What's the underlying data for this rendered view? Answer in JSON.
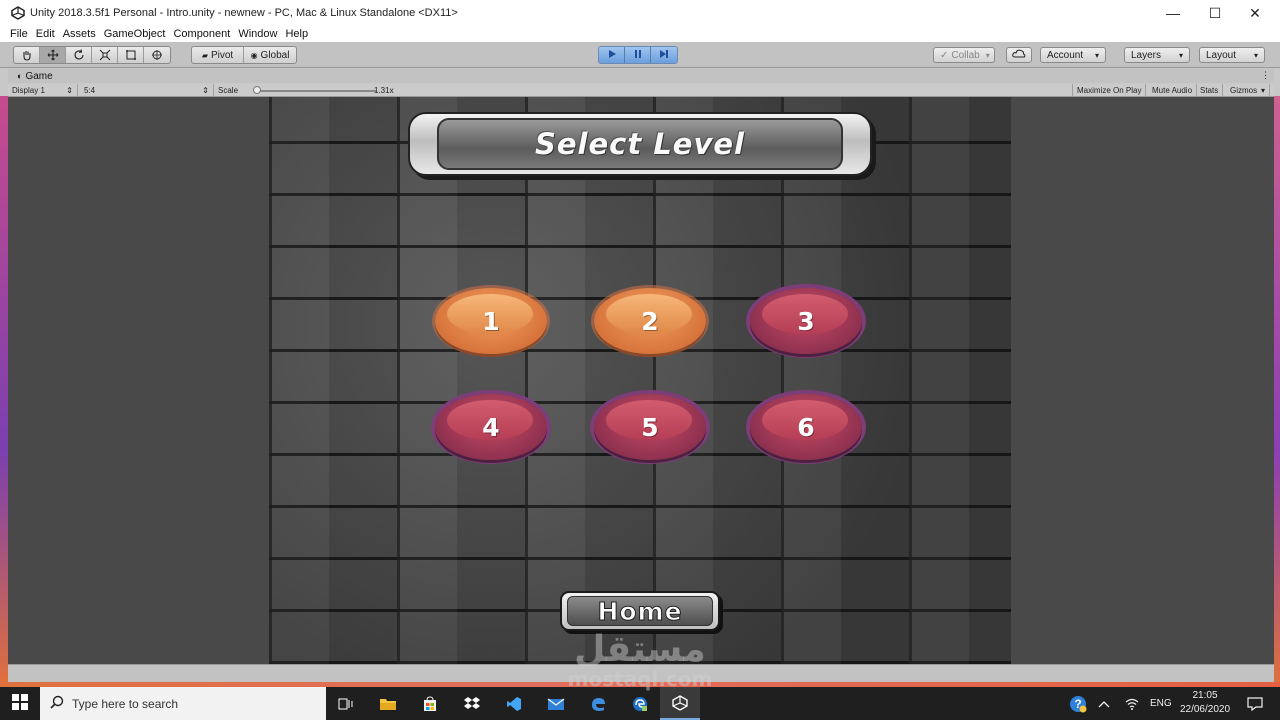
{
  "window": {
    "title": "Unity 2018.3.5f1 Personal - Intro.unity - newnew - PC, Mac & Linux Standalone <DX11>",
    "minimize_glyph": "—",
    "maximize_glyph": "☐",
    "close_glyph": "✕"
  },
  "menu": [
    "File",
    "Edit",
    "Assets",
    "GameObject",
    "Component",
    "Window",
    "Help"
  ],
  "toolbar": {
    "tools": [
      "hand-tool",
      "move-tool",
      "rotate-tool",
      "scale-tool",
      "rect-tool",
      "transform-tool"
    ],
    "active_tool_index": 1,
    "pivot_label": "Pivot",
    "global_label": "Global",
    "collab_label": "Collab",
    "account_label": "Account",
    "layers_label": "Layers",
    "layout_label": "Layout",
    "play_state": "playing"
  },
  "game_panel": {
    "tab_label": "Game",
    "display_label": "Display 1",
    "aspect_label": "5:4",
    "scale_label": "Scale",
    "scale_value": "1.31x",
    "maximize_on_play": "Maximize On Play",
    "mute_audio": "Mute Audio",
    "stats": "Stats",
    "gizmos": "Gizmos"
  },
  "game": {
    "title": "Select Level",
    "levels": [
      {
        "label": "1",
        "state": "unlocked"
      },
      {
        "label": "2",
        "state": "unlocked"
      },
      {
        "label": "3",
        "state": "locked"
      },
      {
        "label": "4",
        "state": "locked"
      },
      {
        "label": "5",
        "state": "locked"
      },
      {
        "label": "6",
        "state": "locked"
      }
    ],
    "home_label": "Home",
    "colors": {
      "unlocked": "#e08848",
      "locked": "#b53e56",
      "locked_ring": "#7c3d78"
    }
  },
  "watermark": {
    "arabic": "مستقل",
    "latin": "mostaql.com"
  },
  "taskbar": {
    "search_placeholder": "Type here to search",
    "apps": [
      "task-view-icon",
      "file-explorer-icon",
      "store-icon",
      "dropbox-icon",
      "visual-studio-icon",
      "mail-icon",
      "edge-icon",
      "edge-dev-icon",
      "unity-icon"
    ],
    "language": "ENG",
    "time": "21:05",
    "date": "22/06/2020"
  }
}
